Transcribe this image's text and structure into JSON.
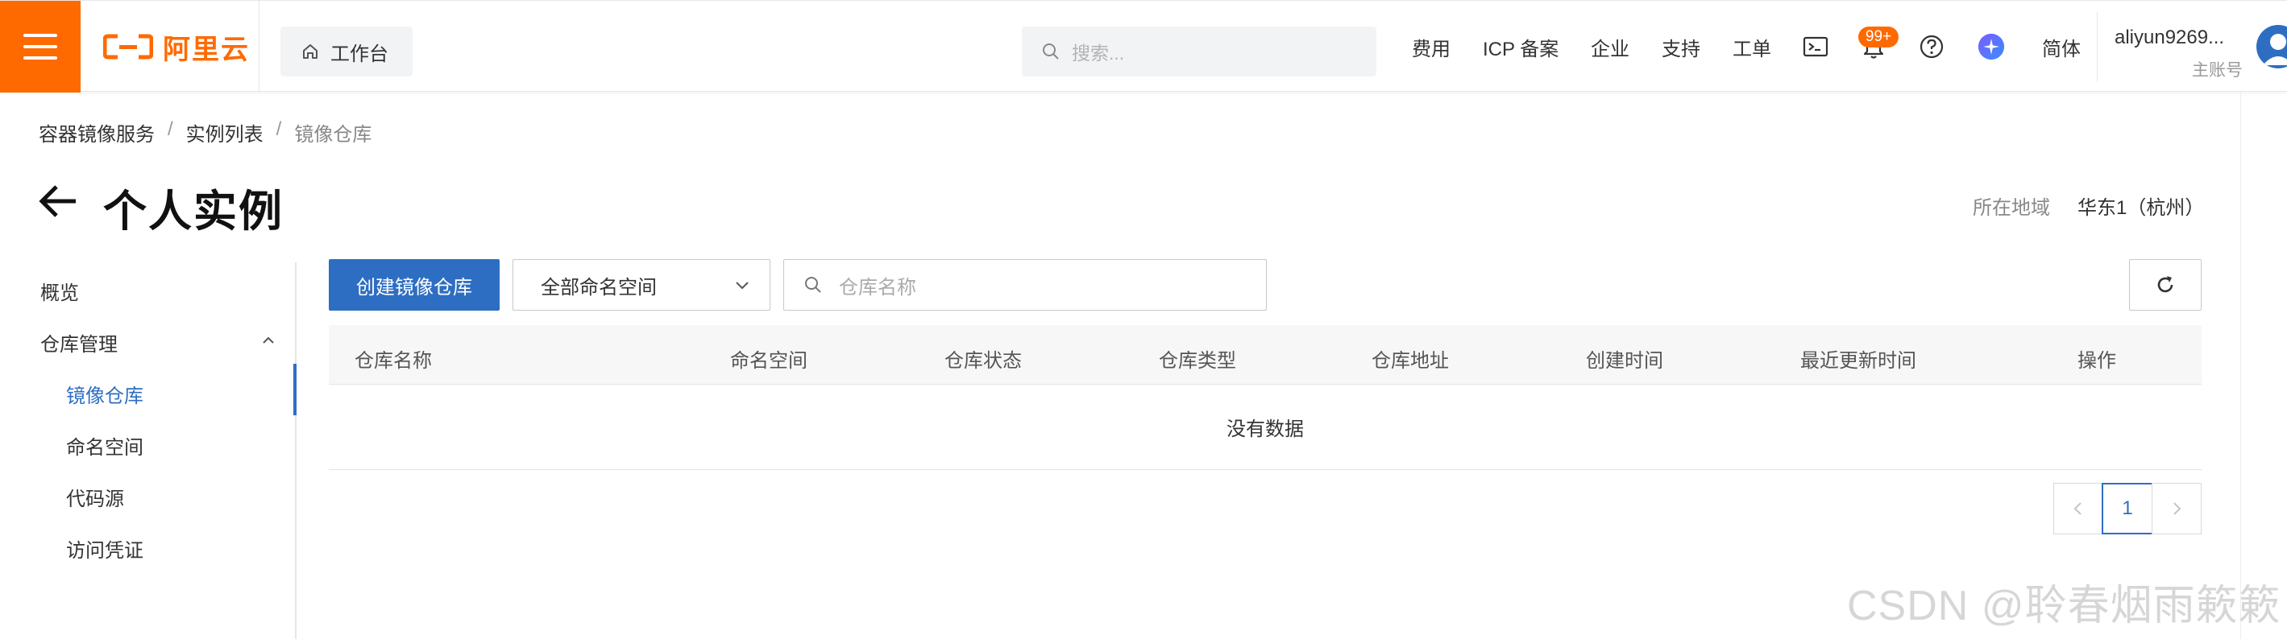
{
  "colors": {
    "brand": "#ff6a00",
    "primary": "#2e6ec2",
    "text": "#333333",
    "muted": "#999999"
  },
  "topbar": {
    "logo_text": "阿里云",
    "workbench_label": "工作台",
    "search_placeholder": "搜索...",
    "nav": [
      "费用",
      "ICP 备案",
      "企业",
      "支持",
      "工单"
    ],
    "notification_badge": "99+",
    "language": "简体",
    "user_name": "aliyun9269...",
    "user_role": "主账号"
  },
  "breadcrumb": [
    "容器镜像服务",
    "实例列表",
    "镜像仓库"
  ],
  "page": {
    "title": "个人实例",
    "region_label": "所在地域",
    "region_value": "华东1（杭州）"
  },
  "sidebar": {
    "overview": "概览",
    "group": "仓库管理",
    "items": [
      "镜像仓库",
      "命名空间",
      "代码源",
      "访问凭证"
    ],
    "active_index": 0
  },
  "toolbar": {
    "create_label": "创建镜像仓库",
    "namespace_selected": "全部命名空间",
    "repo_search_placeholder": "仓库名称"
  },
  "table": {
    "columns": [
      "仓库名称",
      "命名空间",
      "仓库状态",
      "仓库类型",
      "仓库地址",
      "创建时间",
      "最近更新时间",
      "操作"
    ],
    "empty_text": "没有数据"
  },
  "pagination": {
    "current_page": "1"
  },
  "watermark": "CSDN @聆春烟雨簌簌"
}
